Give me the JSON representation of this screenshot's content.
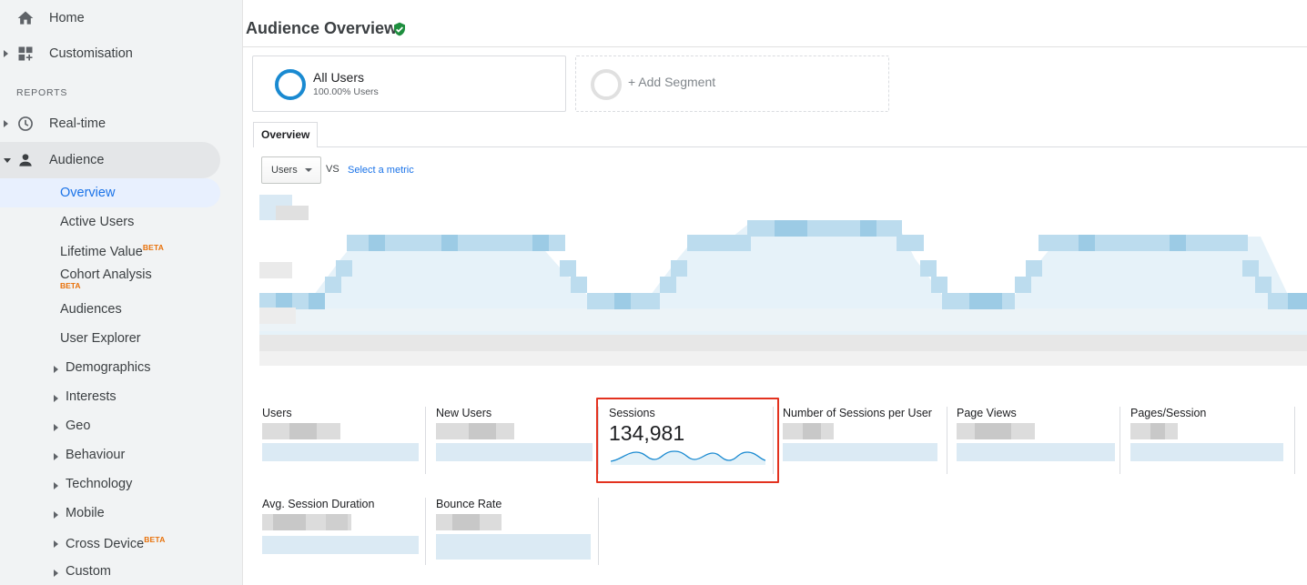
{
  "sidebar": {
    "top_items": [
      {
        "label": "Home",
        "icon": "home-icon"
      },
      {
        "label": "Customisation",
        "icon": "dashboard-grid-icon"
      }
    ],
    "reports_section_label": "REPORTS",
    "realtime_label": "Real-time",
    "audience_label": "Audience",
    "audience_items": [
      {
        "label": "Overview",
        "selected": true
      },
      {
        "label": "Active Users"
      },
      {
        "label": "Lifetime Value",
        "badge": "BETA"
      },
      {
        "label": "Cohort Analysis",
        "badge": "BETA"
      },
      {
        "label": "Audiences"
      },
      {
        "label": "User Explorer"
      },
      {
        "label": "Demographics"
      },
      {
        "label": "Interests"
      },
      {
        "label": "Geo"
      },
      {
        "label": "Behaviour"
      },
      {
        "label": "Technology"
      },
      {
        "label": "Mobile"
      },
      {
        "label": "Cross Device",
        "badge": "BETA"
      },
      {
        "label": "Custom"
      }
    ]
  },
  "header": {
    "title": "Audience Overview",
    "verified_icon": "check-shield-icon"
  },
  "segments": {
    "active": {
      "name": "All Users",
      "sub": "100.00% Users"
    },
    "add_label": "+ Add Segment"
  },
  "tabs": [
    {
      "label": "Overview"
    }
  ],
  "chart_controls": {
    "metric_selected": "Users",
    "vs_label": "VS",
    "select_metric_link": "Select a metric"
  },
  "metrics": [
    {
      "name": "Users",
      "value": ""
    },
    {
      "name": "New Users",
      "value": ""
    },
    {
      "name": "Sessions",
      "value": "134,981"
    },
    {
      "name": "Number of Sessions per User",
      "value": ""
    },
    {
      "name": "Page Views",
      "value": ""
    },
    {
      "name": "Pages/Session",
      "value": ""
    },
    {
      "name": "Avg. Session Duration",
      "value": ""
    },
    {
      "name": "Bounce Rate",
      "value": ""
    }
  ],
  "colors": {
    "accent": "#1a8ad1",
    "highlight_border": "#e3321f",
    "link": "#1a73e8",
    "verified": "#1e8e3e",
    "beta": "#e8710a"
  }
}
